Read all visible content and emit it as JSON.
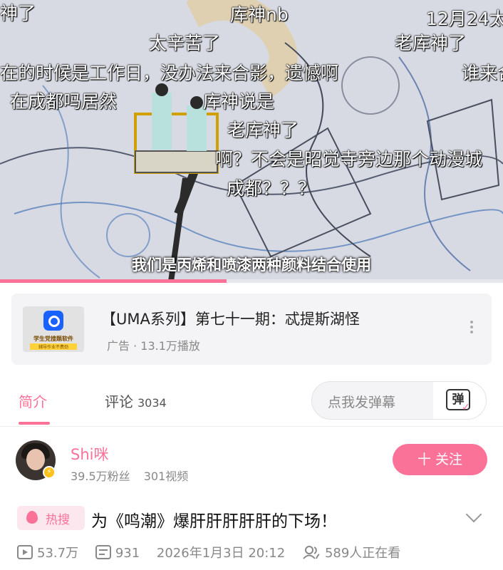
{
  "video": {
    "danmaku": [
      "神了",
      "库神nb",
      "12月24太",
      "太辛苦了",
      "老库神了",
      "在的时候是工作日，没办法来合影，遗憾啊",
      "谁来合",
      "在成都吗居然",
      "库神说是",
      "老库神了",
      "啊？不会是昭觉寺旁边那个动漫城",
      "成都？？？"
    ],
    "subtitle": "我们是丙烯和喷漆两种颜料结合使用",
    "progress_fraction": 0.45,
    "accent_color": "#fb7299"
  },
  "ad": {
    "title": "【UMA系列】第七十一期：忒提斯湖怪",
    "meta": "广告 · 13.1万播放",
    "thumb_text": "学生党搜题软件",
    "thumb_badge": "辅导作业不费劲",
    "more_icon": "more-vertical-icon"
  },
  "tabs": {
    "intro": "简介",
    "comments": "评论",
    "comments_count": "3034",
    "danmaku_placeholder": "点我发弹幕",
    "danmaku_button": "弹"
  },
  "uploader": {
    "name": "Shi咪",
    "fans": "39.5万粉丝",
    "videos": "301视频",
    "follow_label": "十 关注"
  },
  "info": {
    "hot_label": "热搜",
    "title": "为《鸣潮》爆肝肝肝肝肝的下场！",
    "views": "53.7万",
    "danmaku_count": "931",
    "date": "2026年1月3日 20:12",
    "watching": "589人正在看"
  }
}
